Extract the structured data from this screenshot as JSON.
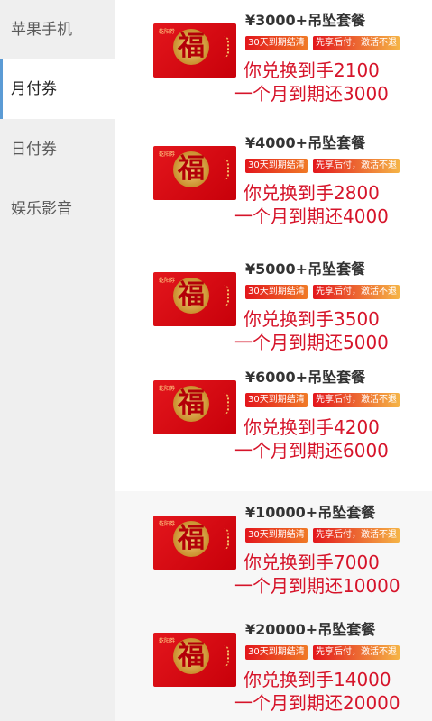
{
  "sidebar": {
    "items": [
      {
        "label": "苹果手机",
        "active": false
      },
      {
        "label": "月付券",
        "active": true
      },
      {
        "label": "日付券",
        "active": false
      },
      {
        "label": "娱乐影音",
        "active": false
      }
    ]
  },
  "thumb": {
    "brand": "乾阳券",
    "glyph": "福"
  },
  "products": [
    {
      "title": "¥3000+吊坠套餐",
      "tag1": "30天到期结清",
      "tag2": "先享后付，激活不退",
      "line1": "你兑换到手2100",
      "line2": "一个月到期还3000"
    },
    {
      "title": "¥4000+吊坠套餐",
      "tag1": "30天到期结清",
      "tag2": "先享后付，激活不退",
      "line1": "你兑换到手2800",
      "line2": "一个月到期还4000"
    },
    {
      "title": "¥5000+吊坠套餐",
      "tag1": "30天到期结清",
      "tag2": "先享后付，激活不退",
      "line1": "你兑换到手3500",
      "line2": "一个月到期还5000"
    },
    {
      "title": "¥6000+吊坠套餐",
      "tag1": "30天到期结清",
      "tag2": "先享后付，激活不退",
      "line1": "你兑换到手4200",
      "line2": "一个月到期还6000"
    },
    {
      "title": "¥10000+吊坠套餐",
      "tag1": "30天到期结清",
      "tag2": "先享后付，激活不退",
      "line1": "你兑换到手7000",
      "line2": "一个月到期还10000"
    },
    {
      "title": "¥20000+吊坠套餐",
      "tag1": "30天到期结清",
      "tag2": "先享后付，激活不退",
      "line1": "你兑换到手14000",
      "line2": "一个月到期还20000"
    }
  ]
}
